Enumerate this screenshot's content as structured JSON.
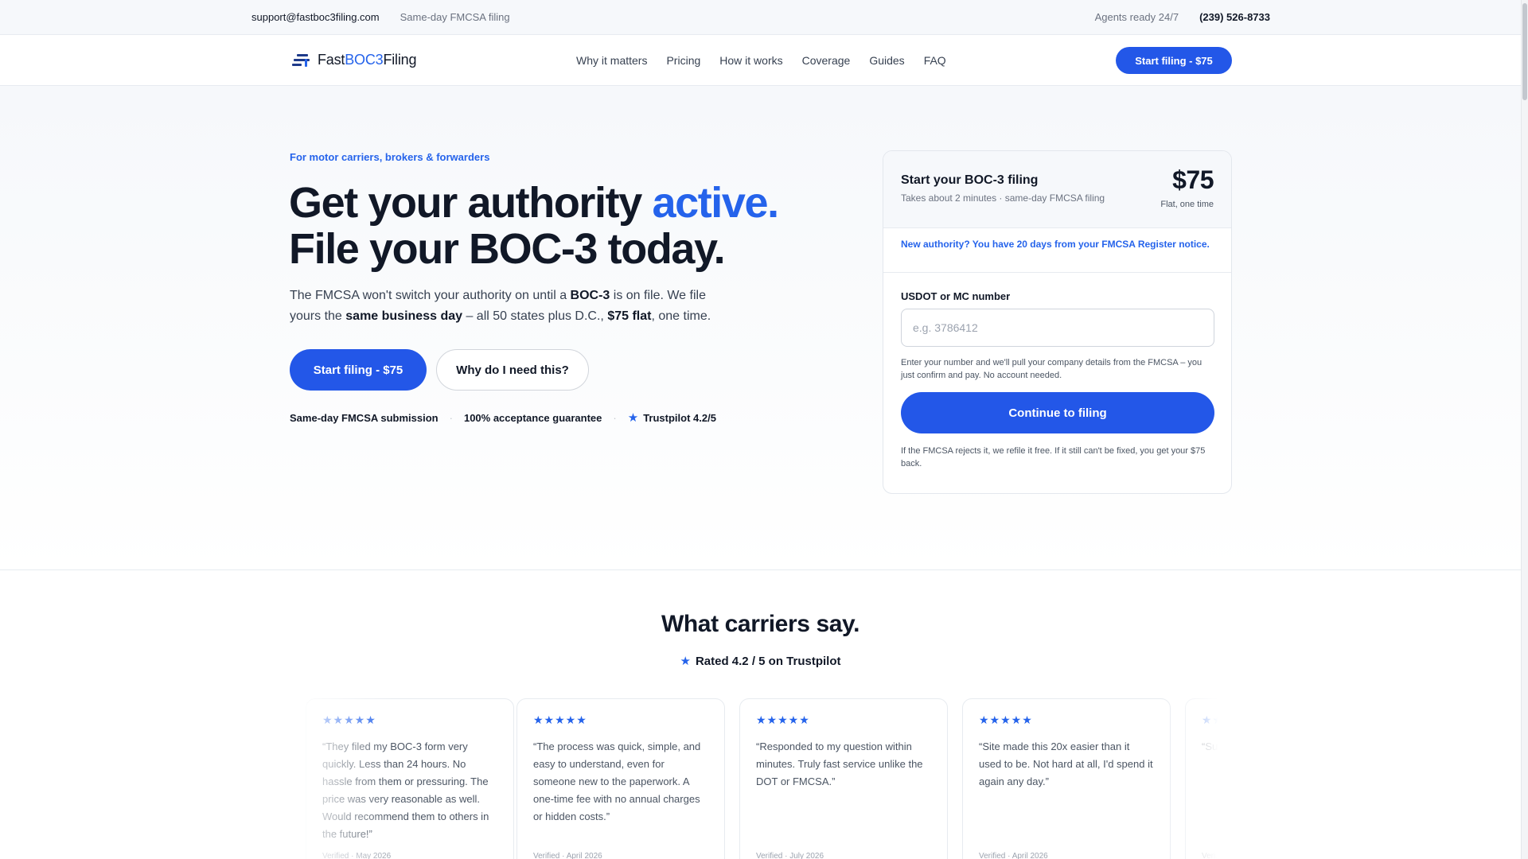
{
  "topbar": {
    "email": "support@fastboc3filing.com",
    "tagline": "Same-day FMCSA filing",
    "agents": "Agents ready 24/7",
    "phone": "(239) 526-8733"
  },
  "brand": {
    "name_part1": "Fast",
    "name_part2": "BOC3",
    "name_part3": "Filing",
    "accent_color": "#2563eb",
    "button_color": "#2357e8"
  },
  "nav": {
    "links": [
      "Why it matters",
      "Pricing",
      "How it works",
      "Coverage",
      "Guides",
      "FAQ"
    ],
    "cta": "Start filing - $75"
  },
  "hero": {
    "eyebrow": "For motor carriers, brokers & forwarders",
    "headline_line1": "Get your authority ",
    "headline_accent": "active.",
    "headline_line2": "File your BOC-3 today.",
    "lede_1": "The FMCSA won't switch your authority on until a ",
    "lede_bold1": "BOC-3",
    "lede_2": " is on file. We file yours the ",
    "lede_bold2": "same business day",
    "lede_3": " – all 50 states plus D.C., ",
    "lede_bold3": "$75 flat",
    "lede_4": ", one time.",
    "primary_cta": "Start filing - $75",
    "secondary_cta": "Why do I need this?",
    "trust": [
      "Same-day FMCSA submission",
      "100% acceptance guarantee",
      "Trustpilot 4.2/5"
    ]
  },
  "form_card": {
    "title": "Start your BOC-3 filing",
    "subtitle": "Takes about 2 minutes · same-day FMCSA filing",
    "price": "$75",
    "price_note": "Flat, one time",
    "notice": "New authority? You have 20 days from your FMCSA Register notice.",
    "field_label": "USDOT or MC number",
    "field_placeholder": "e.g. 3786412",
    "field_value": "",
    "field_help": "Enter your number and we'll pull your company details from the FMCSA – you just confirm and pay. No account needed.",
    "cta": "Continue to filing",
    "footnote": "If the FMCSA rejects it, we refile it free. If it still can't be fixed, you get your $75 back."
  },
  "reviews": {
    "title": "What carriers say.",
    "rating": "Rated 4.2 / 5 on Trustpilot",
    "items": [
      {
        "stars": "★★★★★",
        "quote": "“They filed my BOC-3 form very quickly. Less than 24 hours. No hassle from them or pressuring. The price was very reasonable as well. Would recommend them to others in the future!”",
        "meta": "Verified · May 2026"
      },
      {
        "stars": "★★★★★",
        "quote": "“The process was quick, simple, and easy to understand, even for someone new to the paperwork. A one-time fee with no annual charges or hidden costs.”",
        "meta": "Verified · April 2026"
      },
      {
        "stars": "★★★★★",
        "quote": "“Responded to my question within minutes. Truly fast service unlike the DOT or FMCSA.”",
        "meta": "Verified · July 2026"
      },
      {
        "stars": "★★★★★",
        "quote": "“Site made this 20x easier than it used to be. Not hard at all, I'd spend it again any day.”",
        "meta": "Verified · April 2026"
      },
      {
        "stars": "★★",
        "quote": "“Sup... easi...",
        "meta": "Veri..."
      }
    ]
  }
}
